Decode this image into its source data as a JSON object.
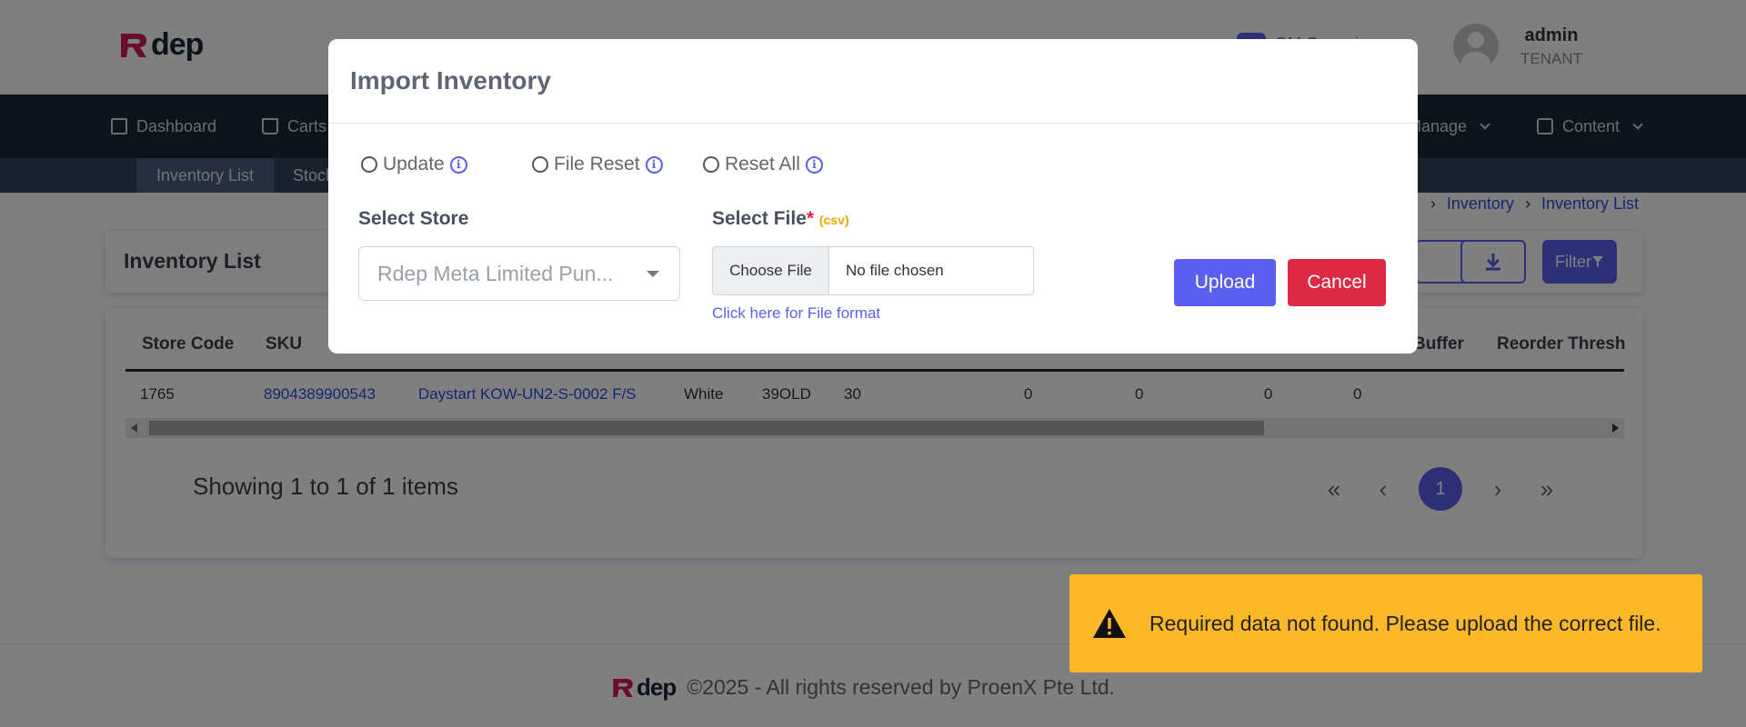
{
  "header": {
    "logo_text": "dep",
    "notification_label": "GM Ceramic",
    "user_name": "admin",
    "user_role": "TENANT"
  },
  "nav": {
    "items": [
      {
        "label": "Dashboard",
        "icon": "dashboard-icon"
      },
      {
        "label": "Carts",
        "icon": "cart-icon"
      },
      {
        "label": "Manage",
        "icon": "manage-icon"
      },
      {
        "label": "Content",
        "icon": "lock-icon"
      }
    ],
    "subnav": [
      "Inventory List",
      "Stock"
    ]
  },
  "breadcrumb": [
    "Inventory",
    "Inventory List"
  ],
  "card": {
    "title": "Inventory List",
    "filter_label": "Filter"
  },
  "table": {
    "headers": [
      "Store Code",
      "SKU",
      "Buffer",
      "Reorder Thresh"
    ],
    "rows": [
      [
        "1765",
        "8904389900543",
        "Daystart KOW-UN2-S-0002 F/S",
        "White",
        "39OLD",
        "30",
        "0",
        "0",
        "0",
        "0"
      ]
    ]
  },
  "pagination": {
    "summary": "Showing 1 to 1 of 1 items",
    "first": "«",
    "prev": "‹",
    "current": "1",
    "next": "›",
    "last": "»"
  },
  "footer": {
    "logo_text": "dep",
    "copyright": "©2025 - All rights reserved by ProenX Pte Ltd."
  },
  "modal": {
    "title": "Import Inventory",
    "radios": [
      {
        "label": "Update",
        "selected": false
      },
      {
        "label": "File Reset",
        "selected": false
      },
      {
        "label": "Reset All",
        "selected": false
      }
    ],
    "info_glyph": "i",
    "store_label": "Select Store",
    "store_value": "Rdep Meta Limited Pun...",
    "file_label": "Select File",
    "file_required": "*",
    "file_hint": "(csv)",
    "choose_file": "Choose File",
    "no_file": "No file chosen",
    "format_link": "Click here for File format",
    "upload": "Upload",
    "cancel": "Cancel"
  },
  "toast": {
    "message": "Required data not found. Please upload the correct file.",
    "icon": "warning-icon",
    "color": "#fdb827"
  },
  "colors": {
    "primary": "#5b5fef",
    "danger": "#dc2a44",
    "nav_bg": "#1d2839",
    "subnav_bg": "#34445e",
    "link": "#2a4fd8"
  }
}
